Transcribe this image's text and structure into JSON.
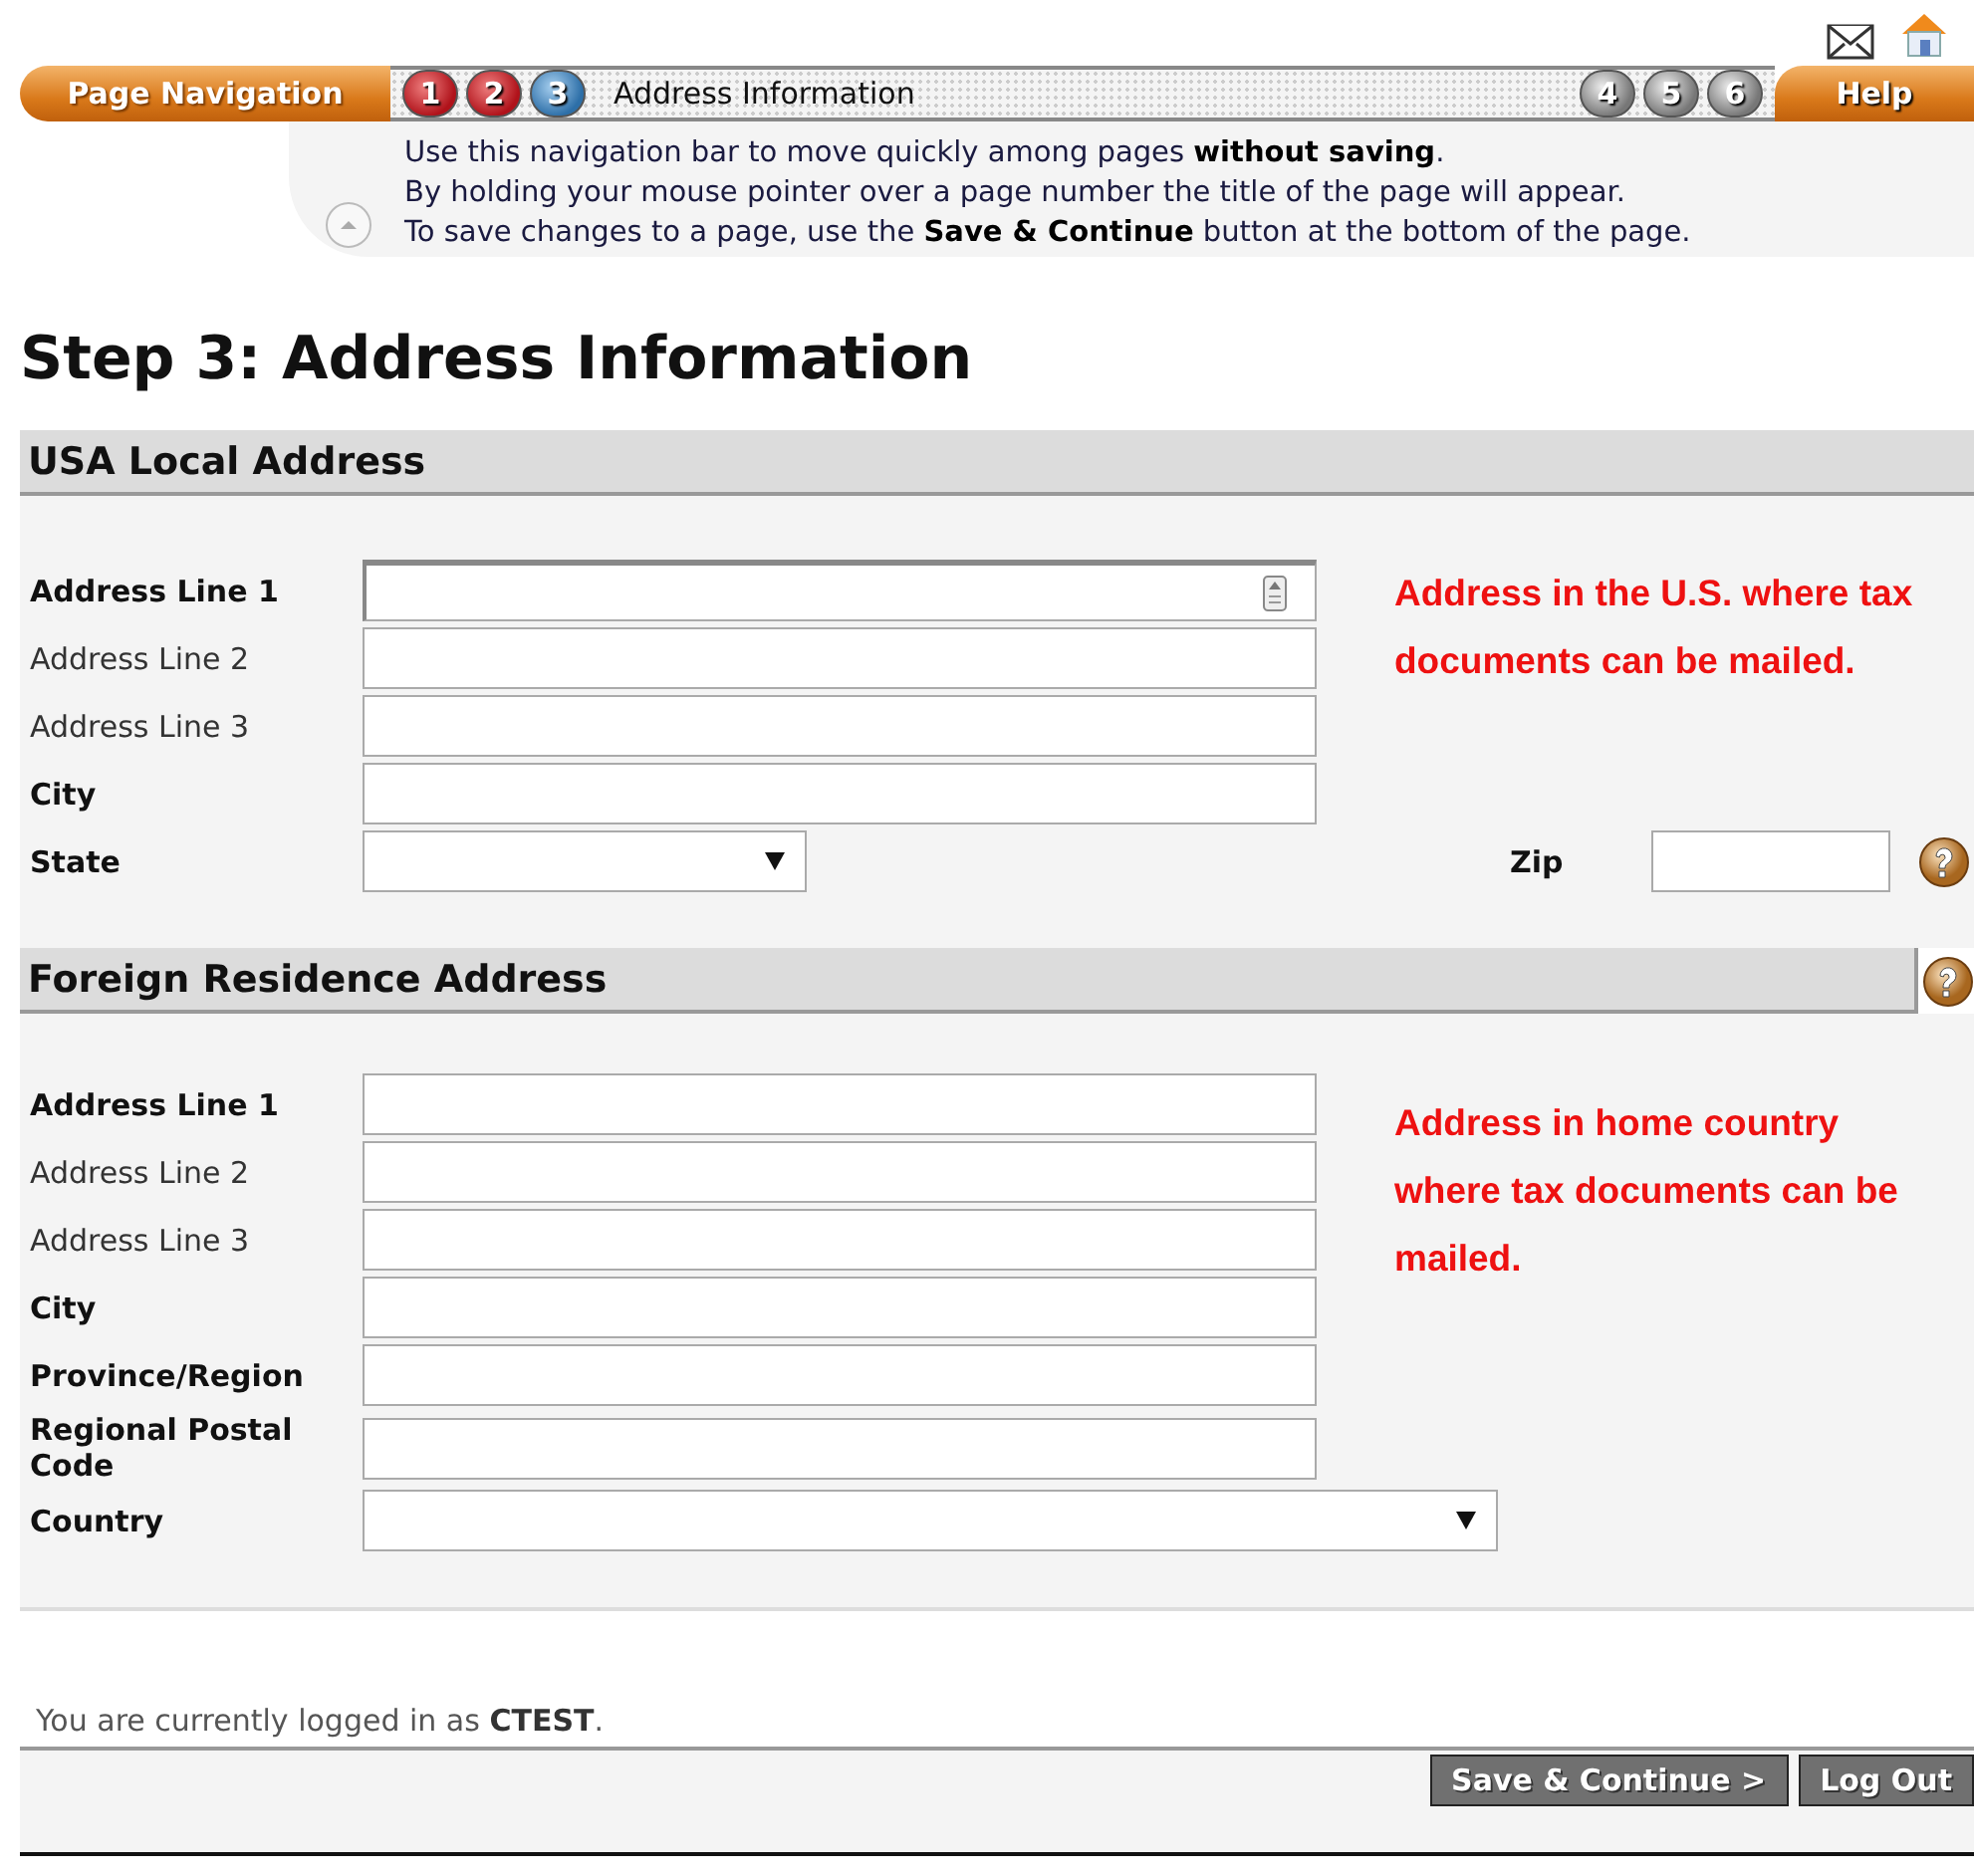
{
  "nav": {
    "title": "Page Navigation",
    "steps": [
      {
        "label": "1",
        "kind": "visited"
      },
      {
        "label": "2",
        "kind": "visited"
      },
      {
        "label": "3",
        "kind": "current"
      },
      {
        "label": "4",
        "kind": "todo"
      },
      {
        "label": "5",
        "kind": "todo"
      },
      {
        "label": "6",
        "kind": "todo"
      }
    ],
    "current_title": "Address Information",
    "help": "Help",
    "info_lines": [
      "Use this navigation bar to move quickly among pages **without saving**.",
      "By holding your mouse pointer over a page number the title of the page will appear.",
      "To save changes to a page, use the **Save & Continue** button at the bottom of the page."
    ]
  },
  "heading": "Step 3: Address Information",
  "sections": [
    {
      "title": "USA Local Address",
      "help_on_header": false,
      "note": [
        "Address in the U.S. where tax",
        "documents can be mailed."
      ],
      "fields": [
        {
          "label": "Address Line 1",
          "required": true,
          "kind": "text",
          "focused": true
        },
        {
          "label": "Address Line 2",
          "required": false,
          "kind": "text",
          "focused": false
        },
        {
          "label": "Address Line 3",
          "required": false,
          "kind": "text",
          "focused": false
        },
        {
          "label": "City",
          "required": true,
          "kind": "text",
          "focused": false
        },
        {
          "label": "State",
          "required": true,
          "kind": "state_zip",
          "zip_label": "Zip"
        }
      ]
    },
    {
      "title": "Foreign Residence Address",
      "help_on_header": true,
      "note": [
        "Address in home country",
        "where tax documents can be",
        "mailed."
      ],
      "fields": [
        {
          "label": "Address Line 1",
          "required": true,
          "kind": "text",
          "focused": false
        },
        {
          "label": "Address Line 2",
          "required": false,
          "kind": "text",
          "focused": false
        },
        {
          "label": "Address Line 3",
          "required": false,
          "kind": "text",
          "focused": false
        },
        {
          "label": "City",
          "required": true,
          "kind": "text",
          "focused": false
        },
        {
          "label": "Province/Region",
          "required": true,
          "kind": "text",
          "focused": false
        },
        {
          "label": "Regional Postal Code",
          "required": true,
          "kind": "text",
          "focused": false
        },
        {
          "label": "Country",
          "required": true,
          "kind": "wide_select"
        }
      ]
    }
  ],
  "footer": {
    "login_text": "You are currently logged in as **CTEST**.",
    "buttons": [
      "Save & Continue >",
      "Log Out"
    ]
  }
}
